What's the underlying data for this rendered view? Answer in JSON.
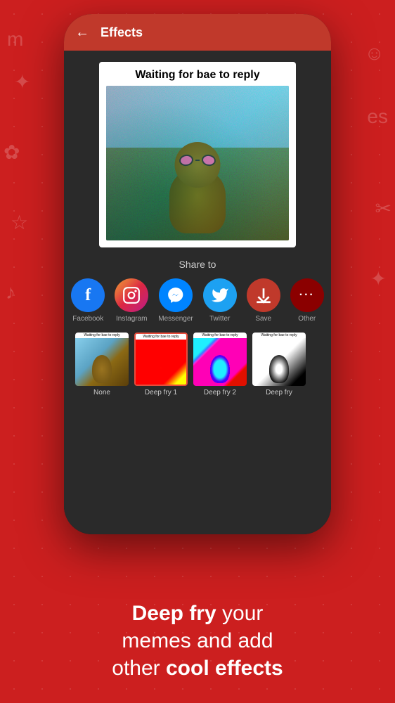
{
  "header": {
    "back_label": "←",
    "title": "Effects"
  },
  "meme": {
    "title": "Waiting for bae to reply"
  },
  "share": {
    "label": "Share to",
    "items": [
      {
        "id": "facebook",
        "label": "Facebook",
        "icon": "f",
        "bg": "fb-bg"
      },
      {
        "id": "instagram",
        "label": "Instagram",
        "icon": "📷",
        "bg": "ig-bg"
      },
      {
        "id": "messenger",
        "label": "Messenger",
        "icon": "✉",
        "bg": "msg-bg"
      },
      {
        "id": "twitter",
        "label": "Twitter",
        "icon": "🐦",
        "bg": "tw-bg"
      },
      {
        "id": "save",
        "label": "Save",
        "icon": "⬇",
        "bg": "save-bg"
      },
      {
        "id": "other",
        "label": "Other",
        "icon": "•••",
        "bg": "other-bg"
      }
    ]
  },
  "effects": [
    {
      "id": "none",
      "label": "None",
      "selected": false
    },
    {
      "id": "deepfry1",
      "label": "Deep fry 1",
      "selected": true
    },
    {
      "id": "deepfry2",
      "label": "Deep fry 2",
      "selected": false
    },
    {
      "id": "deepfry3",
      "label": "Deep fry",
      "selected": false
    }
  ],
  "bottom_text": {
    "line1_bold": "Deep fry",
    "line1_normal": " your",
    "line2": "memes and add",
    "line3_normal": "other ",
    "line3_bold": "cool effects"
  }
}
